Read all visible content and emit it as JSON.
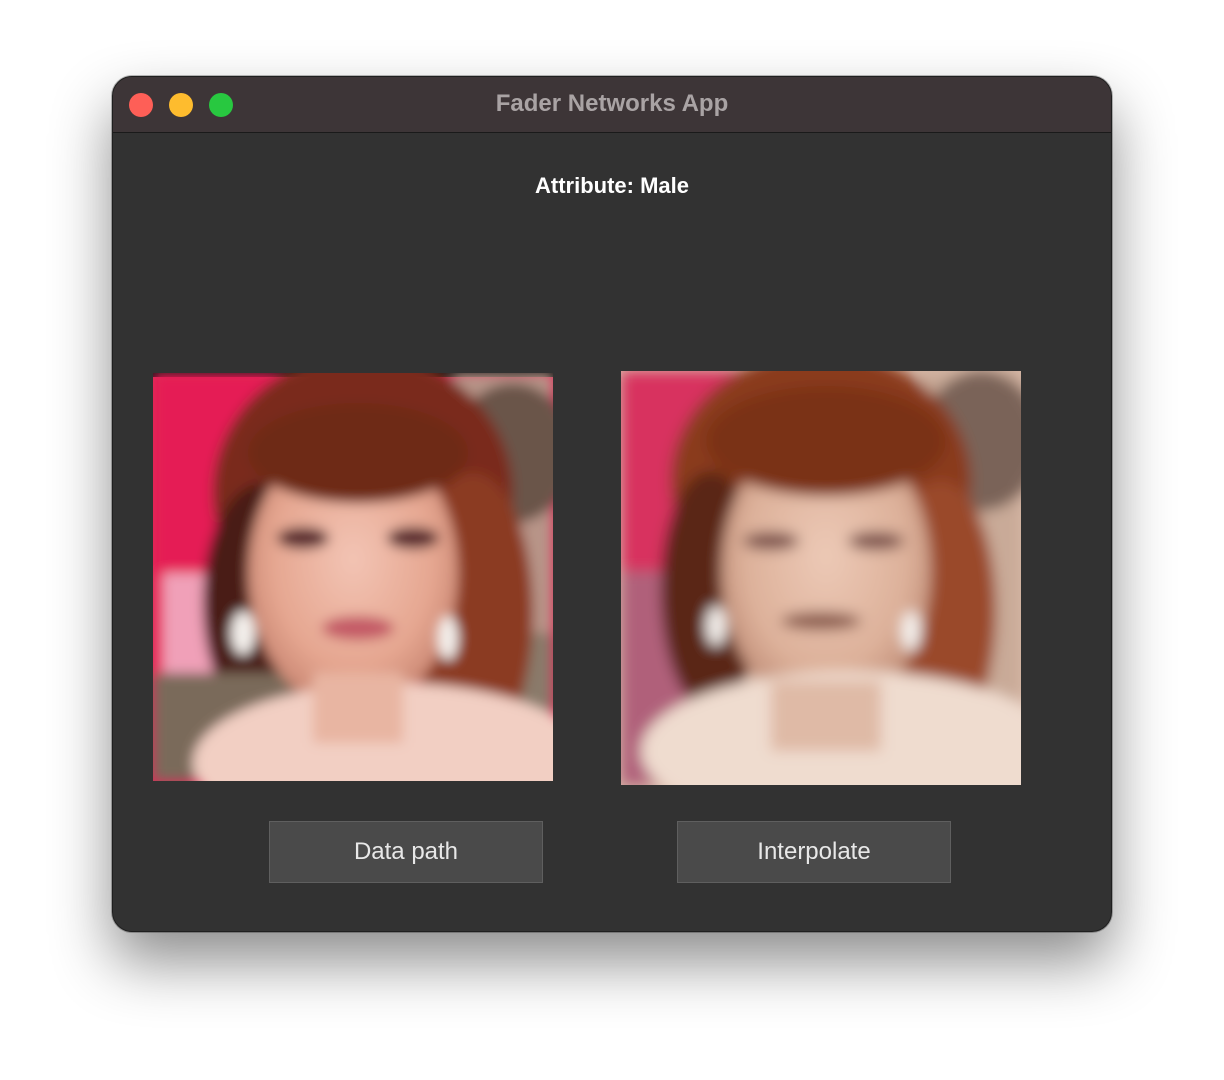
{
  "window": {
    "title": "Fader Networks App"
  },
  "traffic_lights": {
    "close_color": "#fe5f57",
    "minimize_color": "#febc2e",
    "maximize_color": "#28c840"
  },
  "attribute": {
    "label": "Attribute: Male"
  },
  "images": {
    "original": {
      "icon": "face-photo-original"
    },
    "interpolated": {
      "icon": "face-photo-interpolated"
    }
  },
  "buttons": {
    "data_path_label": "Data path",
    "interpolate_label": "Interpolate"
  },
  "colors": {
    "window_bg": "#323232",
    "titlebar_bg": "#3d3537",
    "button_bg": "#4a4a4a"
  }
}
